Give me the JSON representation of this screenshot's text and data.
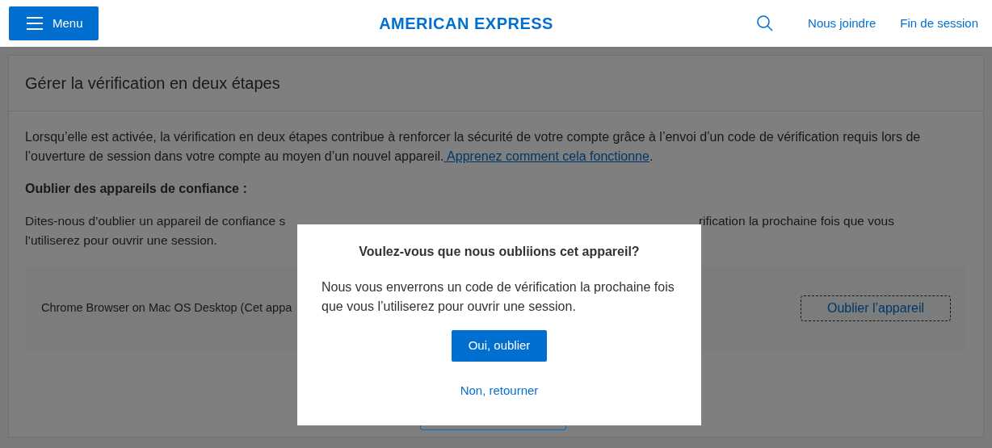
{
  "header": {
    "menu_button": "Menu",
    "logo": "AMERICAN EXPRESS",
    "links": [
      "Nous joindre",
      "Fin de session"
    ]
  },
  "card": {
    "title": "Gérer la vérification en deux étapes",
    "intro": "Lorsqu’elle est activée, la vérification en deux étapes contribue à renforcer la sécurité de votre compte grâce à l’envoi d’un code de vérification requis lors de l’ouverture de session dans votre compte au moyen d’un nouvel appareil.",
    "intro_link": " Apprenez comment cela fonctionne",
    "intro_end": ".",
    "section_heading": "Oublier des appareils de confiance :",
    "partial_line_left": "Dites-nous d’oublier un appareil de confiance s",
    "partial_line_right": "rification la prochaine fois que vous",
    "partial_line_2": "l’utiliserez pour ouvrir une session.",
    "device": {
      "name": "Chrome Browser on Mac OS Desktop (Cet appa",
      "button": "Oublier l’appareil",
      "focused": true
    }
  },
  "dialog": {
    "title": "Voulez-vous que nous oubliions cet appareil?",
    "message": "Nous vous enverrons un code de vérification la prochaine fois que vous l’utiliserez pour ouvrir une session.",
    "confirm": "Oui, oublier",
    "cancel": "Non, retourner"
  }
}
